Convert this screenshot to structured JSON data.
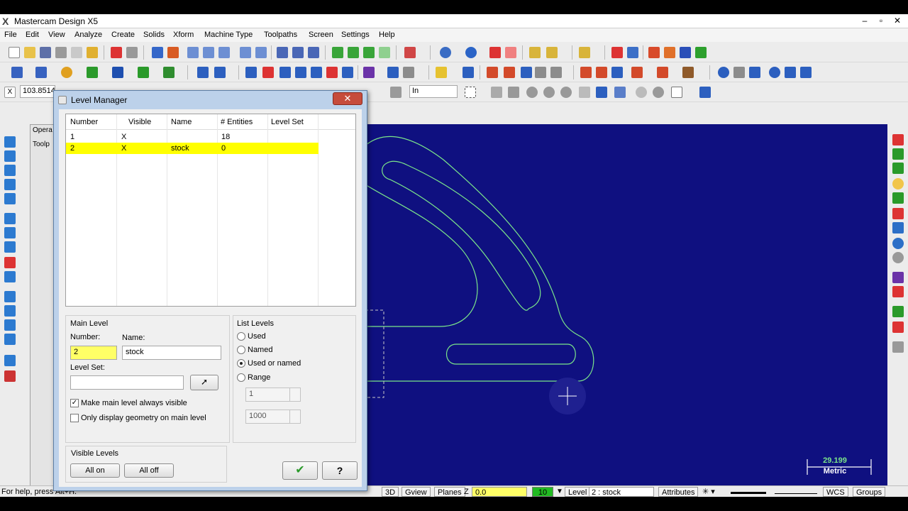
{
  "window": {
    "title": "Mastercam Design X5",
    "logo": "X",
    "minimize": "–",
    "maximize": "▫",
    "close": "✕"
  },
  "menu": [
    "File",
    "Edit",
    "View",
    "Analyze",
    "Create",
    "Solids",
    "Xform",
    "Machine Type",
    "Toolpaths",
    "Screen",
    "Settings",
    "Help"
  ],
  "ribbon": {
    "coord_value": "103.8514",
    "units": "In"
  },
  "ops_manager": {
    "tab1": "Opera",
    "tab2": "Toolp"
  },
  "dialog": {
    "title": "Level Manager",
    "close": "✕",
    "table": {
      "columns": [
        "Number",
        "Visible",
        "Name",
        "# Entities",
        "Level Set"
      ],
      "rows": [
        {
          "number": "1",
          "visible": "X",
          "name": "",
          "entities": "18",
          "level_set": ""
        },
        {
          "number": "2",
          "visible": "X",
          "name": "stock",
          "entities": "0",
          "level_set": ""
        }
      ]
    },
    "main_level": {
      "legend": "Main Level",
      "number_label": "Number:",
      "number_value": "2",
      "name_label": "Name:",
      "name_value": "stock",
      "level_set_label": "Level Set:",
      "level_set_value": "",
      "always_visible_label": "Make main level always visible",
      "always_visible": "✓",
      "only_display_label": "Only display geometry on main level"
    },
    "list_levels": {
      "legend": "List Levels",
      "options": [
        "Used",
        "Named",
        "Used or named",
        "Range"
      ],
      "range_from": "1",
      "range_to": "1000"
    },
    "visible_levels": {
      "legend": "Visible Levels",
      "all_on": "All on",
      "all_off": "All off"
    },
    "ok_icon": "✔",
    "help_icon": "?"
  },
  "graphics": {
    "scale_value": "29.199",
    "scale_unit": "Metric"
  },
  "status": {
    "help_text": "For help, press Alt+H.",
    "view3d": "3D",
    "gview": "Gview",
    "planes": "Planes",
    "z_label": "Z",
    "z_value": "0.0",
    "color_value": "10",
    "level_label": "Level",
    "level_value": "2 : stock",
    "attributes": "Attributes",
    "wcs": "WCS",
    "groups": "Groups"
  },
  "colors": {
    "background": "#0f1080",
    "geometry": "#7be58a",
    "selection": "#ffff00"
  }
}
